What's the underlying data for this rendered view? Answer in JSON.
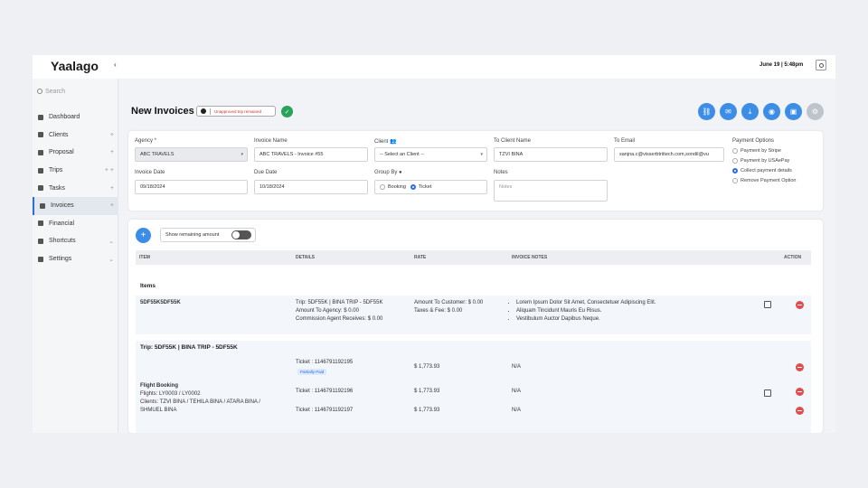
{
  "app": {
    "brand": "Yaalago",
    "collapse_icon": "chevron-left-icon",
    "datetime": "June 19 | 5:48pm",
    "user_icon": "user-icon"
  },
  "sidebar": {
    "search_placeholder": "Search",
    "items": [
      {
        "label": "Dashboard",
        "icon": "dashboard-icon",
        "extra": ""
      },
      {
        "label": "Clients",
        "icon": "clients-icon",
        "extra": "+"
      },
      {
        "label": "Proposal",
        "icon": "proposal-icon",
        "extra": "+"
      },
      {
        "label": "Trips",
        "icon": "trips-icon",
        "extra": "+ +"
      },
      {
        "label": "Tasks",
        "icon": "tasks-icon",
        "extra": "+"
      },
      {
        "label": "Invoices",
        "icon": "invoices-icon",
        "extra": "+"
      },
      {
        "label": "Financial",
        "icon": "financial-icon",
        "extra": ""
      },
      {
        "label": "Shortcuts",
        "icon": "shortcuts-icon",
        "extra": "⌄"
      },
      {
        "label": "Settings",
        "icon": "settings-icon",
        "extra": "⌄"
      }
    ],
    "active_index": 5
  },
  "header": {
    "title": "New Invoices",
    "status_text": "Unapproved trip remained",
    "actions": [
      "link-icon",
      "mail-icon",
      "download-icon",
      "eye-icon",
      "save-icon",
      "settings-icon"
    ]
  },
  "form": {
    "agency_label": "Agency *",
    "agency_value": "ABC TRAVELS",
    "invoice_name_label": "Invoice Name",
    "invoice_name_value": "ABC TRAVELS - Invoice #55",
    "client_label": "Client",
    "client_placeholder": "-- Select an Client --",
    "to_client_label": "To Client Name",
    "to_client_value": "TZVI BINA",
    "to_email_label": "To Email",
    "to_email_value": "sanjna.c@visserbtriitech.com,sondil@vu",
    "invoice_date_label": "Invoice Date",
    "invoice_date_value": "09/18/2024",
    "due_date_label": "Due Date",
    "due_date_value": "10/18/2024",
    "group_by_label": "Group By",
    "group_by_options": [
      "Booking",
      "Ticket"
    ],
    "group_by_selected": "Ticket",
    "notes_label": "Notes",
    "notes_placeholder": "Notes",
    "payment_label": "Payment Options",
    "payment_options": [
      "Payment by Stripe",
      "Payment by USAePay",
      "Collect payment details",
      "Remove Payment Option"
    ],
    "payment_selected": "Collect payment details"
  },
  "table": {
    "toggle_label": "Show remaining amount",
    "headers": [
      "ITEM",
      "DETAILS",
      "RATE",
      "INVOICE NOTES",
      "ACTION"
    ],
    "items_label": "Items",
    "item_row": {
      "item": "5DF55K5DF55K",
      "details": [
        "Trip: 5DF55K | BINA TRIP - 5DF55K",
        "Amount To Agency: $ 0.00",
        "Commission Agent Receives: $ 0.00"
      ],
      "rate": [
        "Amount To Customer: $ 0.00",
        "Taxes & Fee: $ 0.00"
      ],
      "notes": [
        "Lorem Ipsum Dolor Sit Amet, Consectetuer Adipiscing Elit.",
        "Aliquam Tincidunt Mauris Eu Risus.",
        "Vestibulum Auctor Dapibus Neque."
      ]
    },
    "trip_label": "Trip: 5DF55K | BINA TRIP - 5DF55K",
    "flight": {
      "title": "Flight Booking",
      "flights": "Flights: LY0003 / LY0002",
      "clients": "Clients: TZVI BINA / TEHILA BINA / ATARA BINA /",
      "clients2": "SHMUEL BINA",
      "tickets": [
        {
          "ticket": "Ticket : 1146791192195",
          "badge": "Partially Paid",
          "rate": "$ 1,773.93",
          "note": "N/A"
        },
        {
          "ticket": "Ticket : 1146791192196",
          "badge": "",
          "rate": "$ 1,773.93",
          "note": "N/A"
        },
        {
          "ticket": "Ticket : 1146791192197",
          "badge": "",
          "rate": "$ 1,773.93",
          "note": "N/A"
        }
      ]
    }
  }
}
